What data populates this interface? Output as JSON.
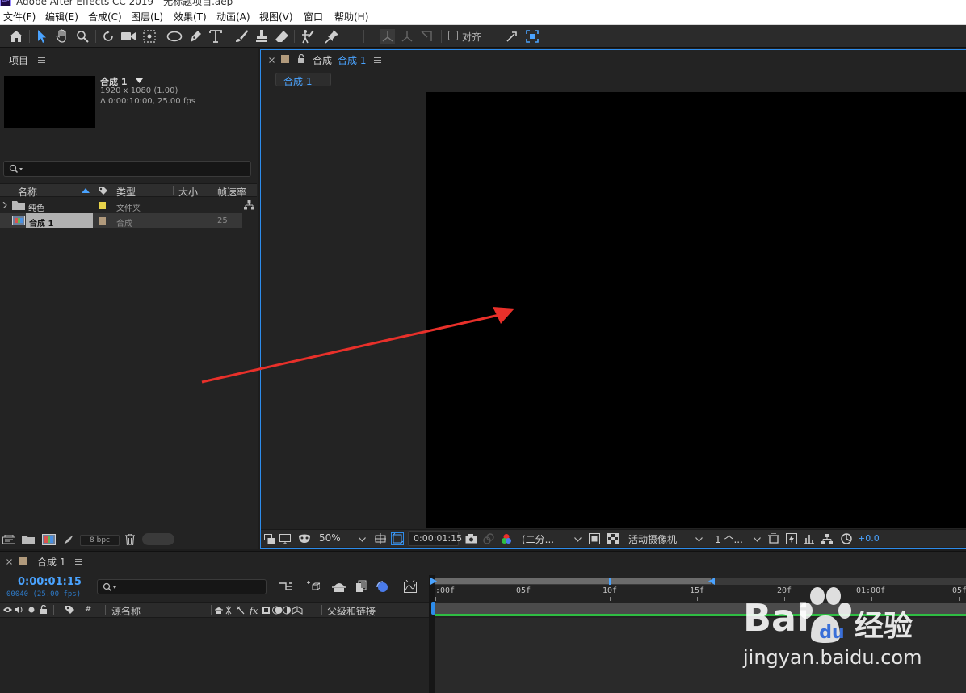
{
  "window": {
    "app_badge": "Ae",
    "title": "Adobe After Effects CC 2019 - 无标题项目.aep"
  },
  "menu": {
    "items": [
      "文件(F)",
      "编辑(E)",
      "合成(C)",
      "图层(L)",
      "效果(T)",
      "动画(A)",
      "视图(V)",
      "窗口",
      "帮助(H)"
    ]
  },
  "toolbar": {
    "snap_label": "对齐"
  },
  "project": {
    "title": "项目",
    "comp_name": "合成 1",
    "comp_dims": "1920 x 1080 (1.00)",
    "comp_duration": "Δ 0:00:10:00, 25.00 fps",
    "columns": {
      "name": "名称",
      "type": "类型",
      "size": "大小",
      "framerate": "帧速率"
    },
    "items": [
      {
        "name": "纯色",
        "type": "文件夹",
        "framerate": "",
        "label_color": "#e6d24a"
      },
      {
        "name": "合成 1",
        "type": "合成",
        "framerate": "25",
        "label_color": "#b19a7c"
      }
    ],
    "bpc": "8 bpc"
  },
  "viewer": {
    "tab_prefix": "合成",
    "tab_name": "合成 1",
    "sub_tab": "合成 1",
    "zoom": "50%",
    "timecode": "0:00:01:15",
    "resolution": "(二分...",
    "camera": "活动摄像机",
    "views": "1 个...",
    "exposure": "+0.0"
  },
  "timeline": {
    "tab_name": "合成 1",
    "current_time": "0:00:01:15",
    "frame_info": "00040 (25.00 fps)",
    "columns": {
      "hash": "#",
      "source_name": "源名称",
      "parent_link": "父级和链接"
    },
    "ruler": [
      ":00f",
      "05f",
      "10f",
      "15f",
      "20f",
      "01:00f",
      "05f"
    ]
  },
  "watermark": {
    "brand": "Bai",
    "brand_cn": "经验",
    "url": "jingyan.baidu.com"
  },
  "colors": {
    "accent_blue": "#2d8ceb",
    "annotation_red": "#e8302a",
    "track_green": "#2fbd43"
  }
}
